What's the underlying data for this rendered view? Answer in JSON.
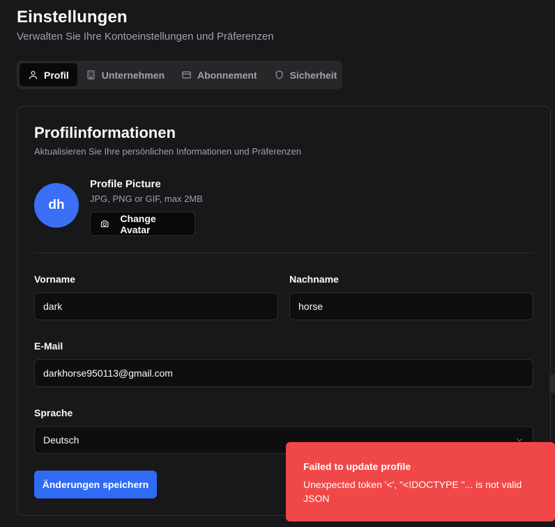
{
  "header": {
    "title": "Einstellungen",
    "subtitle": "Verwalten Sie Ihre Kontoeinstellungen und Präferenzen"
  },
  "tabs": [
    {
      "label": "Profil",
      "icon": "user-icon",
      "active": true
    },
    {
      "label": "Unternehmen",
      "icon": "building-icon",
      "active": false
    },
    {
      "label": "Abonnement",
      "icon": "credit-card-icon",
      "active": false
    },
    {
      "label": "Sicherheit",
      "icon": "shield-icon",
      "active": false
    }
  ],
  "card": {
    "title": "Profilinformationen",
    "subtitle": "Aktualisieren Sie Ihre persönlichen Informationen und Präferenzen"
  },
  "avatar": {
    "initials": "dh",
    "title": "Profile Picture",
    "hint": "JPG, PNG or GIF, max 2MB",
    "button_label": "Change Avatar",
    "button_icon": "camera-icon"
  },
  "form": {
    "first_name": {
      "label": "Vorname",
      "value": "dark"
    },
    "last_name": {
      "label": "Nachname",
      "value": "horse"
    },
    "email": {
      "label": "E-Mail",
      "value": "darkhorse950113@gmail.com"
    },
    "language": {
      "label": "Sprache",
      "value": "Deutsch"
    },
    "save_label": "Änderungen speichern"
  },
  "toast": {
    "title": "Failed to update profile",
    "message": "Unexpected token '<', \"<!DOCTYPE \"... is not valid JSON"
  },
  "colors": {
    "background": "#18181b",
    "primary": "#2f6bf5",
    "avatar": "#3b6ff6",
    "error": "#f04848"
  }
}
